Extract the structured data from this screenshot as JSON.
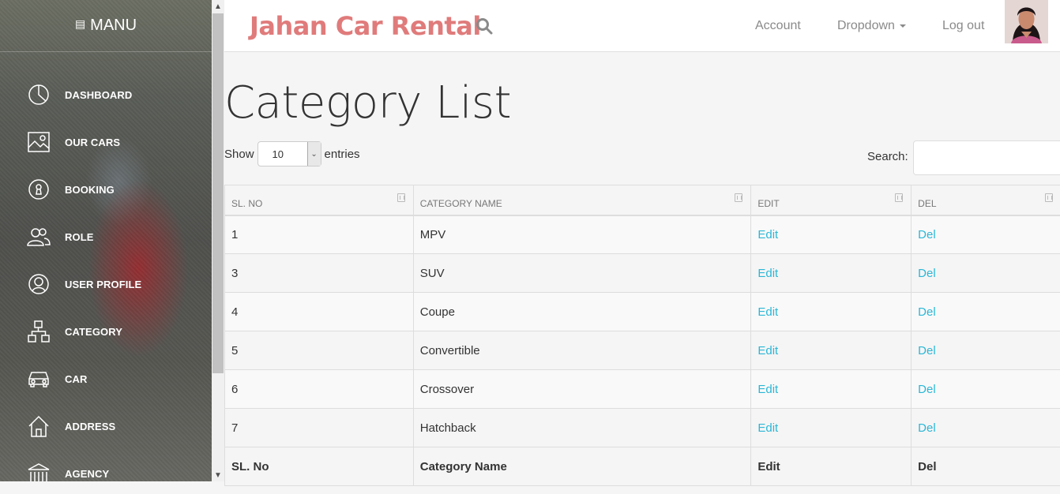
{
  "sidebar": {
    "header": "MANU",
    "items": [
      {
        "label": "DASHBOARD",
        "icon": "pie-chart-icon"
      },
      {
        "label": "OUR CARS",
        "icon": "image-icon"
      },
      {
        "label": "BOOKING",
        "icon": "keyhole-icon"
      },
      {
        "label": "ROLE",
        "icon": "users-icon"
      },
      {
        "label": "USER PROFILE",
        "icon": "user-icon"
      },
      {
        "label": "CATEGORY",
        "icon": "sitemap-icon"
      },
      {
        "label": "CAR",
        "icon": "car-icon"
      },
      {
        "label": "ADDRESS",
        "icon": "home-icon"
      },
      {
        "label": "AGENCY",
        "icon": "bank-icon"
      }
    ]
  },
  "header": {
    "brand": "Jahan Car Rental",
    "account": "Account",
    "dropdown": "Dropdown",
    "logout": "Log out"
  },
  "page": {
    "title": "Category List",
    "show_label": "Show",
    "entries_label": "entries",
    "page_size": "10",
    "search_label": "Search:"
  },
  "table": {
    "headers": [
      "SL. NO",
      "CATEGORY NAME",
      "EDIT",
      "DEL"
    ],
    "rows": [
      {
        "sl": "1",
        "name": "MPV",
        "edit": "Edit",
        "del": "Del"
      },
      {
        "sl": "3",
        "name": "SUV",
        "edit": "Edit",
        "del": "Del"
      },
      {
        "sl": "4",
        "name": "Coupe",
        "edit": "Edit",
        "del": "Del"
      },
      {
        "sl": "5",
        "name": "Convertible",
        "edit": "Edit",
        "del": "Del"
      },
      {
        "sl": "6",
        "name": "Crossover",
        "edit": "Edit",
        "del": "Del"
      },
      {
        "sl": "7",
        "name": "Hatchback",
        "edit": "Edit",
        "del": "Del"
      }
    ],
    "footer": [
      "SL. No",
      "Category Name",
      "Edit",
      "Del"
    ]
  },
  "colors": {
    "brand": "#e07b7b",
    "link": "#2ab7d6"
  }
}
